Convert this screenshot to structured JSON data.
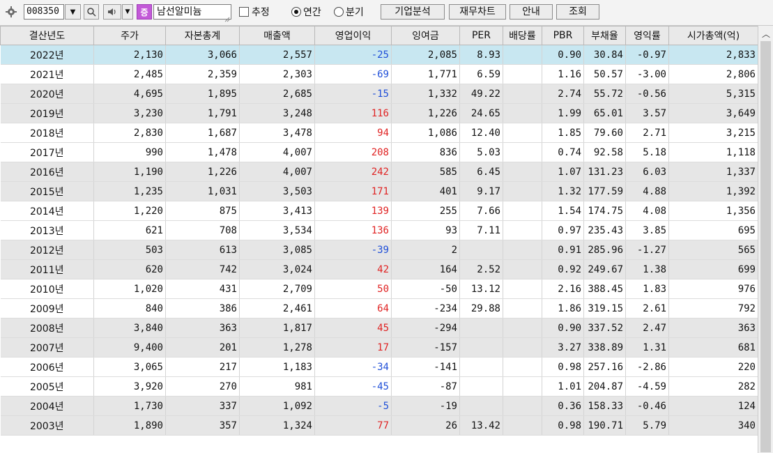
{
  "toolbar": {
    "code_value": "008350",
    "badge": "증",
    "stock_name": "남선알미늄",
    "estimate_label": "추정",
    "annual_label": "연간",
    "quarter_label": "분기",
    "annual_selected": true,
    "btn_company": "기업분석",
    "btn_finchart": "재무차트",
    "btn_guide": "안내",
    "btn_query": "조회"
  },
  "table": {
    "headers": [
      "결산년도",
      "주가",
      "자본총계",
      "매출액",
      "영업이익",
      "잉여금",
      "PER",
      "배당률",
      "PBR",
      "부채율",
      "영익률",
      "시가총액(억)"
    ],
    "rows": [
      [
        "2022년",
        "2,130",
        "3,066",
        "2,557",
        "-25",
        "2,085",
        "8.93",
        "",
        "0.90",
        "30.84",
        "-0.97",
        "2,833"
      ],
      [
        "2021년",
        "2,485",
        "2,359",
        "2,303",
        "-69",
        "1,771",
        "6.59",
        "",
        "1.16",
        "50.57",
        "-3.00",
        "2,806"
      ],
      [
        "2020년",
        "4,695",
        "1,895",
        "2,685",
        "-15",
        "1,332",
        "49.22",
        "",
        "2.74",
        "55.72",
        "-0.56",
        "5,315"
      ],
      [
        "2019년",
        "3,230",
        "1,791",
        "3,248",
        "116",
        "1,226",
        "24.65",
        "",
        "1.99",
        "65.01",
        "3.57",
        "3,649"
      ],
      [
        "2018년",
        "2,830",
        "1,687",
        "3,478",
        "94",
        "1,086",
        "12.40",
        "",
        "1.85",
        "79.60",
        "2.71",
        "3,215"
      ],
      [
        "2017년",
        "990",
        "1,478",
        "4,007",
        "208",
        "836",
        "5.03",
        "",
        "0.74",
        "92.58",
        "5.18",
        "1,118"
      ],
      [
        "2016년",
        "1,190",
        "1,226",
        "4,007",
        "242",
        "585",
        "6.45",
        "",
        "1.07",
        "131.23",
        "6.03",
        "1,337"
      ],
      [
        "2015년",
        "1,235",
        "1,031",
        "3,503",
        "171",
        "401",
        "9.17",
        "",
        "1.32",
        "177.59",
        "4.88",
        "1,392"
      ],
      [
        "2014년",
        "1,220",
        "875",
        "3,413",
        "139",
        "255",
        "7.66",
        "",
        "1.54",
        "174.75",
        "4.08",
        "1,356"
      ],
      [
        "2013년",
        "621",
        "708",
        "3,534",
        "136",
        "93",
        "7.11",
        "",
        "0.97",
        "235.43",
        "3.85",
        "695"
      ],
      [
        "2012년",
        "503",
        "613",
        "3,085",
        "-39",
        "2",
        "",
        "",
        "0.91",
        "285.96",
        "-1.27",
        "565"
      ],
      [
        "2011년",
        "620",
        "742",
        "3,024",
        "42",
        "164",
        "2.52",
        "",
        "0.92",
        "249.67",
        "1.38",
        "699"
      ],
      [
        "2010년",
        "1,020",
        "431",
        "2,709",
        "50",
        "-50",
        "13.12",
        "",
        "2.16",
        "388.45",
        "1.83",
        "976"
      ],
      [
        "2009년",
        "840",
        "386",
        "2,461",
        "64",
        "-234",
        "29.88",
        "",
        "1.86",
        "319.15",
        "2.61",
        "792"
      ],
      [
        "2008년",
        "3,840",
        "363",
        "1,817",
        "45",
        "-294",
        "",
        "",
        "0.90",
        "337.52",
        "2.47",
        "363"
      ],
      [
        "2007년",
        "9,400",
        "201",
        "1,278",
        "17",
        "-157",
        "",
        "",
        "3.27",
        "338.89",
        "1.31",
        "681"
      ],
      [
        "2006년",
        "3,065",
        "217",
        "1,183",
        "-34",
        "-141",
        "",
        "",
        "0.98",
        "257.16",
        "-2.86",
        "220"
      ],
      [
        "2005년",
        "3,920",
        "270",
        "981",
        "-45",
        "-87",
        "",
        "",
        "1.01",
        "204.87",
        "-4.59",
        "282"
      ],
      [
        "2004년",
        "1,730",
        "337",
        "1,092",
        "-5",
        "-19",
        "",
        "",
        "0.36",
        "158.33",
        "-0.46",
        "124"
      ],
      [
        "2003년",
        "1,890",
        "357",
        "1,324",
        "77",
        "26",
        "13.42",
        "",
        "0.98",
        "190.71",
        "5.79",
        "340"
      ]
    ]
  },
  "colors": {
    "selected_row": "#c8e7f1",
    "negative": "#1f4fd8",
    "positive": "#e02323",
    "alt_row": "#e6e6e6"
  }
}
